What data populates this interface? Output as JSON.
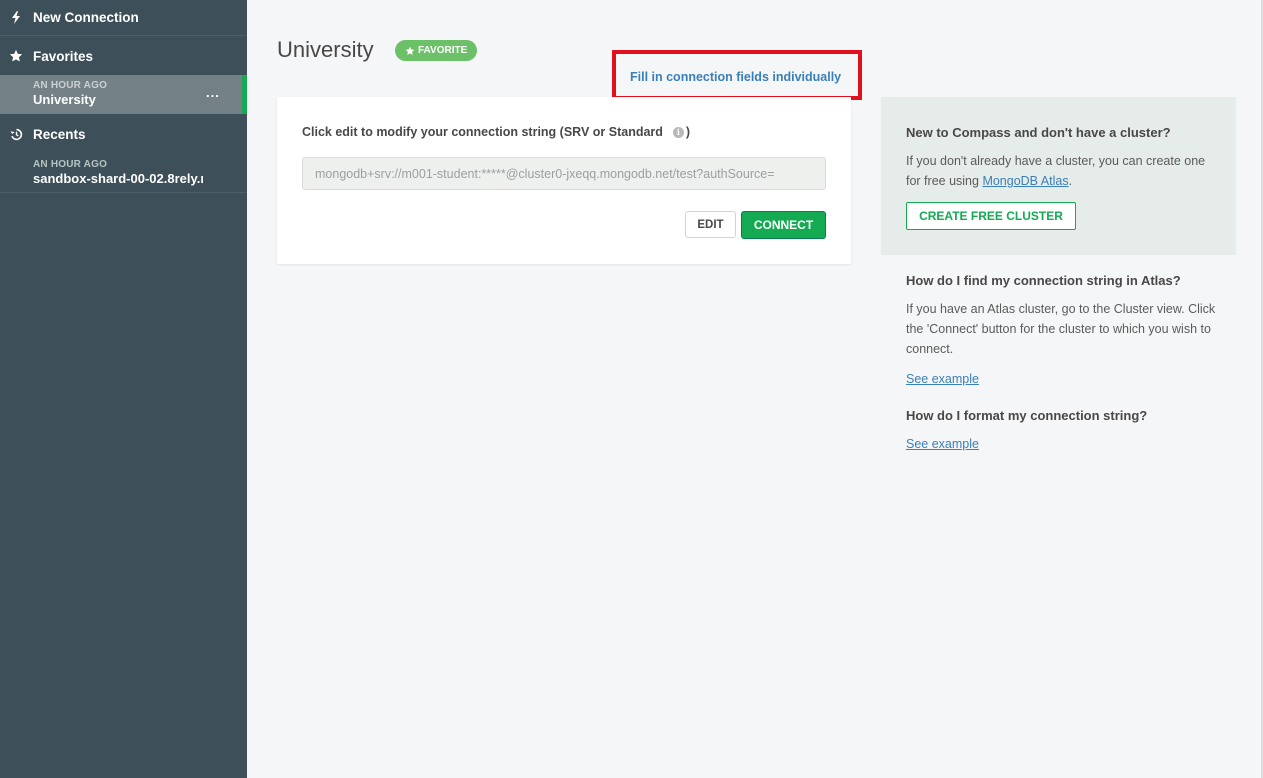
{
  "sidebar": {
    "new_connection": "New Connection",
    "favorites_label": "Favorites",
    "favorites": [
      {
        "time": "AN HOUR AGO",
        "name": "University",
        "menu": "..."
      }
    ],
    "recents_label": "Recents",
    "recents": [
      {
        "time": "AN HOUR AGO",
        "name": "sandbox-shard-00-02.8rely.r"
      }
    ]
  },
  "main": {
    "title": "University",
    "favorite_badge": "FAVORITE",
    "fill_link": "Fill in connection fields individually",
    "card": {
      "label": "Click edit to modify your connection string (SRV or Standard",
      "label_close": ")",
      "connection_string": "mongodb+srv://m001-student:*****@cluster0-jxeqq.mongodb.net/test?authSource=",
      "edit_label": "EDIT",
      "connect_label": "CONNECT"
    }
  },
  "help": {
    "cluster_heading": "New to Compass and don't have a cluster?",
    "cluster_text_1": "If you don't already have a cluster, you can create one for free using ",
    "cluster_link": "MongoDB Atlas",
    "cluster_text_2": ".",
    "create_button": "CREATE FREE CLUSTER",
    "find_heading": "How do I find my connection string in Atlas?",
    "find_text": "If you have an Atlas cluster, go to the Cluster view. Click the 'Connect' button for the cluster to which you wish to connect.",
    "find_link": "See example",
    "format_heading": "How do I format my connection string?",
    "format_link": "See example"
  },
  "colors": {
    "sidebar_bg": "#3d4f58",
    "accent_green": "#13aa52",
    "link_blue": "#3a7fb8",
    "highlight_red": "#e0111c"
  },
  "icons": {
    "new_connection": "bolt-icon",
    "favorites": "star-icon",
    "recents": "history-icon",
    "info": "info-icon"
  }
}
